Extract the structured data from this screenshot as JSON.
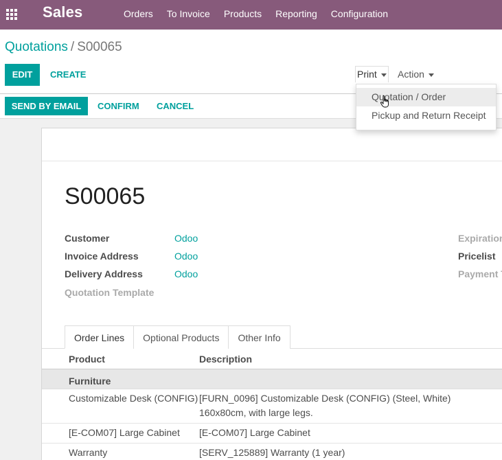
{
  "nav": {
    "app_title": "Sales",
    "menu": [
      "Orders",
      "To Invoice",
      "Products",
      "Reporting",
      "Configuration"
    ]
  },
  "breadcrumb": {
    "parent": "Quotations",
    "separator": "/",
    "current": "S00065"
  },
  "buttons": {
    "edit": "Edit",
    "create": "Create",
    "print": "Print",
    "action": "Action",
    "send_by_email": "Send by Email",
    "confirm": "Confirm",
    "cancel": "Cancel"
  },
  "print_menu": [
    "Quotation / Order",
    "Pickup and Return Receipt"
  ],
  "record": {
    "name": "S00065",
    "fields": {
      "customer_label": "Customer",
      "customer_value": "Odoo",
      "invoice_address_label": "Invoice Address",
      "invoice_address_value": "Odoo",
      "delivery_address_label": "Delivery Address",
      "delivery_address_value": "Odoo",
      "quotation_template_label": "Quotation Template",
      "expiration_label": "Expiration",
      "pricelist_label": "Pricelist",
      "payment_terms_label": "Payment T"
    }
  },
  "tabs": [
    "Order Lines",
    "Optional Products",
    "Other Info"
  ],
  "order_lines": {
    "columns": [
      "Product",
      "Description"
    ],
    "section": "Furniture",
    "rows": [
      {
        "product": "Customizable Desk (CONFIG)",
        "description_1": "[FURN_0096] Customizable Desk (CONFIG) (Steel, White)",
        "description_2": "160x80cm, with large legs."
      },
      {
        "product": "[E-COM07] Large Cabinet",
        "description_1": "[E-COM07] Large Cabinet",
        "description_2": ""
      },
      {
        "product": "Warranty",
        "description_1": "[SERV_125889] Warranty (1 year)",
        "description_2": ""
      }
    ]
  },
  "colors": {
    "navbar": "#875a7b",
    "accent": "#00a09d"
  }
}
